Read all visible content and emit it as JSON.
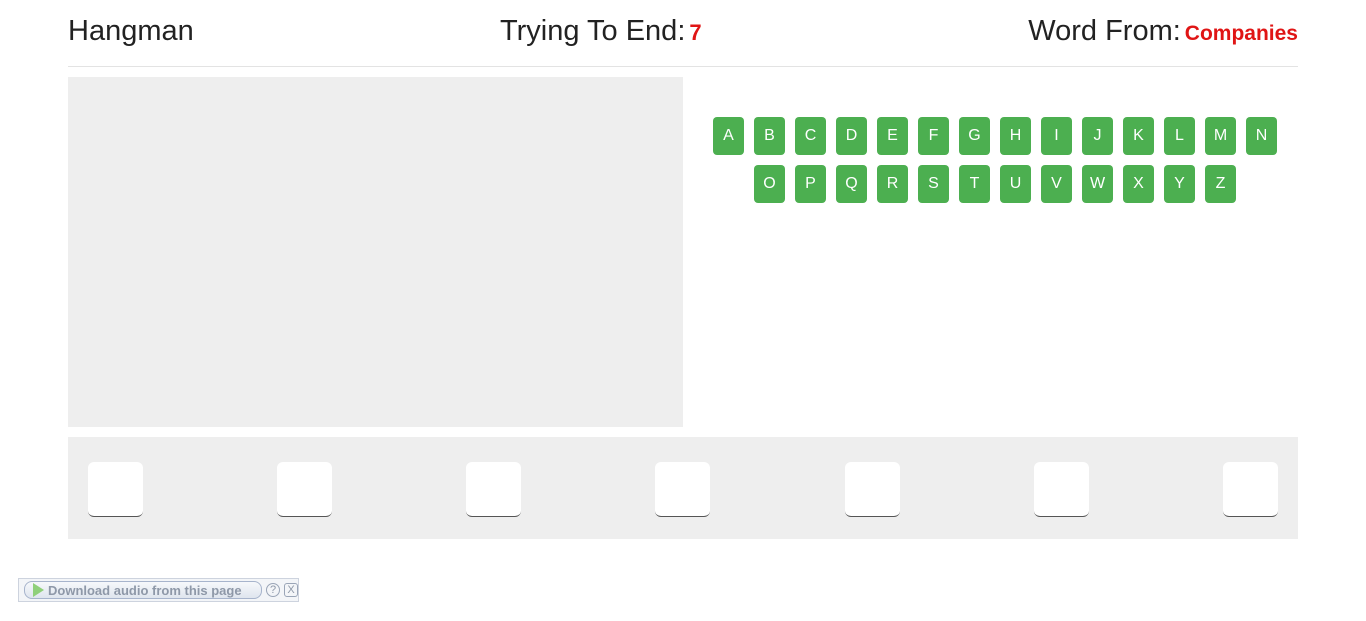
{
  "header": {
    "title": "Hangman",
    "lives_label": "Trying To End:",
    "lives_value": "7",
    "category_label": "Word From:",
    "category_value": "Companies"
  },
  "keyboard": {
    "row1": [
      "A",
      "B",
      "C",
      "D",
      "E",
      "F",
      "G",
      "H",
      "I",
      "J",
      "K",
      "L",
      "M",
      "N"
    ],
    "row2": [
      "O",
      "P",
      "Q",
      "R",
      "S",
      "T",
      "U",
      "V",
      "W",
      "X",
      "Y",
      "Z"
    ],
    "color": "#4caf50"
  },
  "word": {
    "slots": [
      "",
      "",
      "",
      "",
      "",
      "",
      ""
    ]
  },
  "download_bar": {
    "label": "Download audio from this page",
    "help": "?",
    "close": "X"
  },
  "colors": {
    "accent": "#e01515",
    "panel": "#eeeeee"
  }
}
